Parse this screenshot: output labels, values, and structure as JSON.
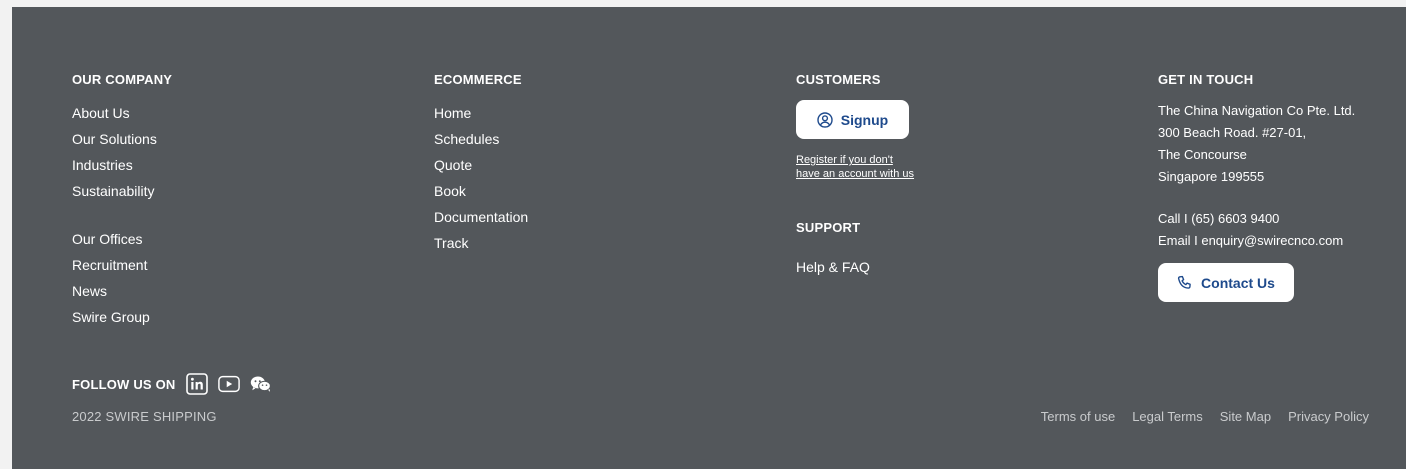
{
  "company": {
    "heading": "OUR COMPANY",
    "group1": [
      "About Us",
      "Our Solutions",
      "Industries",
      "Sustainability"
    ],
    "group2": [
      "Our Offices",
      "Recruitment",
      "News",
      "Swire Group"
    ]
  },
  "ecommerce": {
    "heading": "ECOMMERCE",
    "items": [
      "Home",
      "Schedules",
      "Quote",
      "Book",
      "Documentation",
      "Track"
    ]
  },
  "customers": {
    "heading": "CUSTOMERS",
    "signup_label": "Signup",
    "register_line1": "Register if you don't",
    "register_line2": "have an account with us"
  },
  "support": {
    "heading": "SUPPORT",
    "help_label": "Help & FAQ"
  },
  "contact": {
    "heading": "GET IN TOUCH",
    "address": [
      "The China Navigation Co Pte. Ltd.",
      "300 Beach Road. #27-01,",
      "The Concourse",
      "Singapore 199555"
    ],
    "call": "Call I (65) 6603 9400",
    "email": "Email I enquiry@swirecnco.com",
    "contact_label": "Contact Us"
  },
  "social": {
    "label": "FOLLOW US ON",
    "icons": [
      "linkedin-icon",
      "youtube-icon",
      "wechat-icon"
    ]
  },
  "copyright": "2022 SWIRE SHIPPING",
  "legal": [
    "Terms of use",
    "Legal Terms",
    "Site Map",
    "Privacy Policy"
  ],
  "colors": {
    "footer_bg": "#53575b",
    "button_text": "#1e4a8c",
    "muted_text": "#c9cbcd"
  }
}
